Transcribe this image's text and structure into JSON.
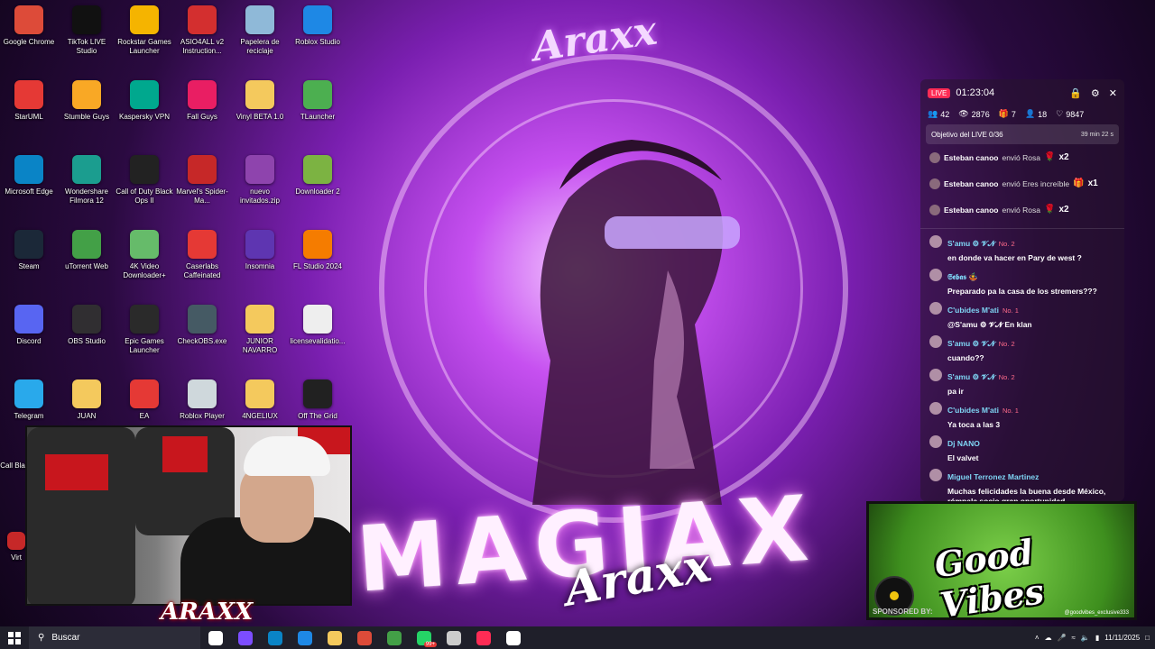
{
  "desktop": {
    "icons": [
      {
        "label": "Google Chrome",
        "icon": "chrome-icon",
        "color": "#dd4b39"
      },
      {
        "label": "TikTok LIVE Studio",
        "icon": "tiktok-icon",
        "color": "#111111"
      },
      {
        "label": "Rockstar Games Launcher",
        "icon": "rockstar-icon",
        "color": "#f5b400"
      },
      {
        "label": "ASIO4ALL v2 Instruction...",
        "icon": "pdf-icon",
        "color": "#d32f2f"
      },
      {
        "label": "Papelera de reciclaje",
        "icon": "recycle-bin-icon",
        "color": "#8fb9d8"
      },
      {
        "label": "Roblox Studio",
        "icon": "roblox-studio-icon",
        "color": "#1e88e5"
      },
      {
        "label": "StarUML",
        "icon": "staruml-icon",
        "color": "#e53935"
      },
      {
        "label": "Stumble Guys",
        "icon": "stumble-guys-icon",
        "color": "#f9a825"
      },
      {
        "label": "Kaspersky VPN",
        "icon": "kaspersky-icon",
        "color": "#00a88e"
      },
      {
        "label": "Fall Guys",
        "icon": "fall-guys-icon",
        "color": "#e91e63"
      },
      {
        "label": "Vinyl BETA 1.0",
        "icon": "folder-icon",
        "color": "#f4c95d"
      },
      {
        "label": "TLauncher",
        "icon": "tlauncher-icon",
        "color": "#4caf50"
      },
      {
        "label": "Microsoft Edge",
        "icon": "edge-icon",
        "color": "#0a84c6"
      },
      {
        "label": "Wondershare Filmora 12",
        "icon": "filmora-icon",
        "color": "#1b9d8f"
      },
      {
        "label": "Call of Duty Black Ops II",
        "icon": "cod-icon",
        "color": "#222222"
      },
      {
        "label": "Marvel's Spider-Ma...",
        "icon": "spiderman-icon",
        "color": "#c62828"
      },
      {
        "label": "nuevo invitados.zip",
        "icon": "zip-icon",
        "color": "#8e44ad"
      },
      {
        "label": "Downloader 2",
        "icon": "downloader-icon",
        "color": "#7cb342"
      },
      {
        "label": "Steam",
        "icon": "steam-icon",
        "color": "#1b2838"
      },
      {
        "label": "uTorrent Web",
        "icon": "utorrent-icon",
        "color": "#43a047"
      },
      {
        "label": "4K Video Downloader+",
        "icon": "4k-downloader-icon",
        "color": "#66bb6a"
      },
      {
        "label": "Caserlabs Caffeinated",
        "icon": "caffeinated-icon",
        "color": "#e53935"
      },
      {
        "label": "Insomnia",
        "icon": "insomnia-icon",
        "color": "#5e35b1"
      },
      {
        "label": "FL Studio 2024",
        "icon": "fl-studio-icon",
        "color": "#f57c00"
      },
      {
        "label": "Discord",
        "icon": "discord-icon",
        "color": "#5865f2"
      },
      {
        "label": "OBS Studio",
        "icon": "obs-icon",
        "color": "#302e31"
      },
      {
        "label": "Epic Games Launcher",
        "icon": "epic-games-icon",
        "color": "#2a2a2a"
      },
      {
        "label": "CheckOBS.exe",
        "icon": "checkobs-icon",
        "color": "#455a64"
      },
      {
        "label": "JUNIOR NAVARRO",
        "icon": "folder-icon",
        "color": "#f4c95d"
      },
      {
        "label": "licensevalidatio...",
        "icon": "document-icon",
        "color": "#eeeeee"
      },
      {
        "label": "Telegram",
        "icon": "telegram-icon",
        "color": "#29a9eb"
      },
      {
        "label": "JUAN",
        "icon": "folder-icon",
        "color": "#f4c95d"
      },
      {
        "label": "EA",
        "icon": "ea-icon",
        "color": "#e53935"
      },
      {
        "label": "Roblox Player",
        "icon": "roblox-icon",
        "color": "#cfd8dc"
      },
      {
        "label": "4NGELIUX",
        "icon": "folder-icon",
        "color": "#f4c95d"
      },
      {
        "label": "Off The Grid",
        "icon": "off-the-grid-icon",
        "color": "#212121"
      }
    ],
    "partial_labels": [
      "Call Black",
      "Virt"
    ]
  },
  "wallpaper": {
    "tag_top": "Araxx",
    "big_title": "MAGIAX",
    "tag_bottom": "Araxx"
  },
  "live_panel": {
    "badge": "LIVE",
    "timer": "01:23:04",
    "stats": {
      "viewers": "42",
      "views": "2876",
      "gifts": "7",
      "followers": "18",
      "likes": "9847"
    },
    "goal": {
      "label": "Objetivo del LIVE 0/36",
      "time_left": "39 min 22 s",
      "progress": 0
    },
    "gifts": [
      {
        "user": "Esteban canoo",
        "action": "envió Rosa",
        "count": "x2",
        "gift_icon": "rose-icon"
      },
      {
        "user": "Esteban canoo",
        "action": "envió Eres increíble",
        "count": "x1",
        "gift_icon": "gift-icon"
      },
      {
        "user": "Esteban canoo",
        "action": "envió Rosa",
        "count": "x2",
        "gift_icon": "rose-icon"
      }
    ],
    "messages": [
      {
        "user": "S'amu ⚙ 𝓥𝓝",
        "badge": "No. 2",
        "text": "en donde va hacer en Pary de west ?"
      },
      {
        "user": "𝕾𝖊𝖇𝖆𝖘 🤹",
        "badge": "",
        "text": "Preparado pa la casa de los stremers???"
      },
      {
        "user": "C'ubides M'ati",
        "badge": "No. 1",
        "text": "@S'amu ⚙ 𝓥𝓝 En klan"
      },
      {
        "user": "S'amu ⚙ 𝓥𝓝",
        "badge": "No. 2",
        "text": "cuando??"
      },
      {
        "user": "S'amu ⚙ 𝓥𝓝",
        "badge": "No. 2",
        "text": "pa ir"
      },
      {
        "user": "C'ubides M'ati",
        "badge": "No. 1",
        "text": "Ya toca a las 3"
      },
      {
        "user": "Dj NANO",
        "badge": "",
        "text": "El valvet"
      },
      {
        "user": "Miguel Terronez Martinez",
        "badge": "",
        "text": "Muchas felicidades la buena desde México, rómpala socio gran oportunidad."
      }
    ]
  },
  "webcam": {
    "logo": "ARAXX"
  },
  "sponsor": {
    "title": "Good Vibes",
    "label": "SPONSORED BY:",
    "handle": "@goodvibes_exclusive333"
  },
  "taskbar": {
    "search_placeholder": "Buscar",
    "apps": [
      {
        "icon": "task-view-icon",
        "color": "#ffffff"
      },
      {
        "icon": "copilot-icon",
        "color": "#7c4dff"
      },
      {
        "icon": "edge-icon",
        "color": "#0a84c6"
      },
      {
        "icon": "store-icon",
        "color": "#1e88e5"
      },
      {
        "icon": "file-explorer-icon",
        "color": "#f4c95d"
      },
      {
        "icon": "chrome-icon",
        "color": "#dd4b39"
      },
      {
        "icon": "chrome-profile-icon",
        "color": "#43a047"
      },
      {
        "icon": "whatsapp-icon",
        "color": "#25d366",
        "badge": "99+"
      },
      {
        "icon": "obs-icon",
        "color": "#cccccc"
      },
      {
        "icon": "tiktok-icon",
        "color": "#fe2c55"
      },
      {
        "icon": "tiktok-live-studio-icon",
        "color": "#ffffff"
      }
    ],
    "date": "11/11/2025"
  }
}
